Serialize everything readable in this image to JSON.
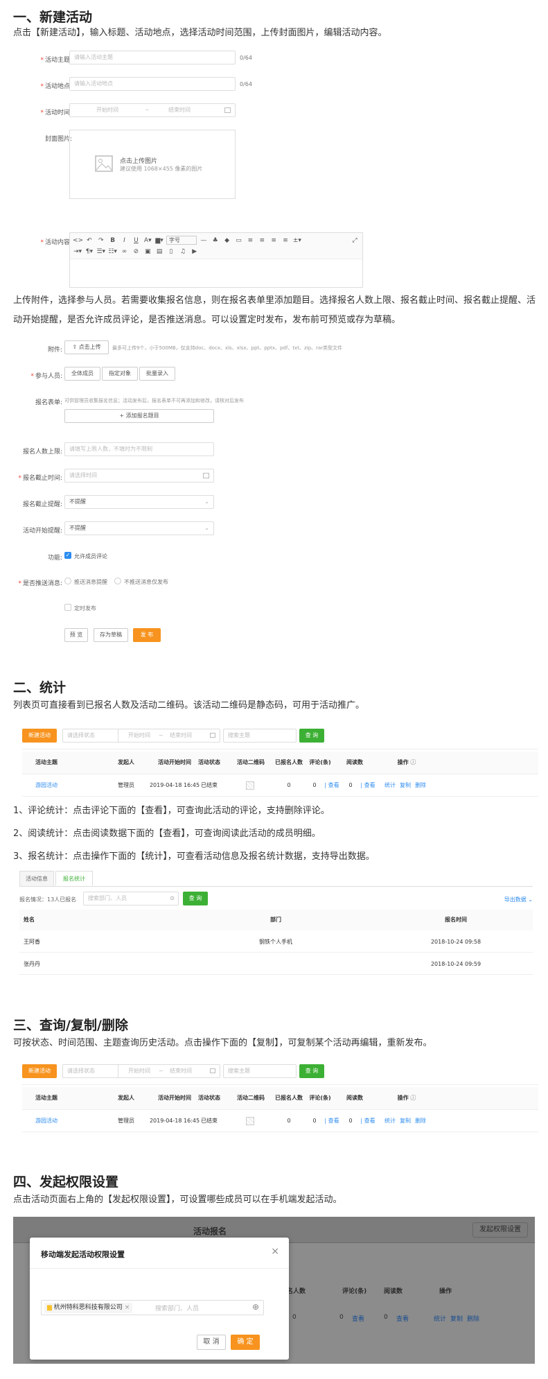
{
  "s1": {
    "heading": "一、新建活动",
    "desc": "点击【新建活动】，输入标题、活动地点，选择活动时间范围，上传封面图片，编辑活动内容。",
    "theme_label": "活动主题:",
    "theme_placeholder": "请输入活动主题",
    "theme_count": "0/64",
    "place_label": "活动地点:",
    "place_placeholder": "请输入活动地点",
    "place_count": "0/64",
    "time_label": "活动时间:",
    "time_start": "开始时间",
    "time_sep": "~",
    "time_end": "结束时间",
    "cover_label": "封面图片:",
    "cover_upload": "点击上传图片",
    "cover_hint": "建议使用 1068×455 像素的图片",
    "content_label": "活动内容:",
    "font_size": "字号"
  },
  "s1b": {
    "desc": "上传附件，选择参与人员。若需要收集报名信息，则在报名表单里添加题目。选择报名人数上限、报名截止时间、报名截止提醒、活动开始提醒，是否允许成员评论，是否推送消息。可以设置定时发布，发布前可预览或存为草稿。",
    "attach_label": "附件:",
    "attach_btn": "点击上传",
    "attach_hint": "最多可上传9个，小于500MB，仅支持doc、docx、xls、xlsx、ppt、pptx、pdf、txt、zip、rar类型文件",
    "people_label": "参与人员:",
    "people_all": "全体成员",
    "people_specified": "指定对象",
    "people_batch": "批量录入",
    "form_label": "报名表单:",
    "form_hint": "可供管理员收集报名信息；活动发布后，报名表单不可再添加和修改，请核对后发布",
    "form_add": "添加报名题目",
    "limit_label": "报名人数上限:",
    "limit_placeholder": "请填写上限人数，不填时为不限制",
    "deadline_label": "报名截止时间:",
    "deadline_placeholder": "请选择时间",
    "remind_label": "报名截止提醒:",
    "remind_value": "不提醒",
    "start_remind_label": "活动开始提醒:",
    "start_remind_value": "不提醒",
    "func_label": "功能:",
    "func_allow": "允许成员评论",
    "push_label": "是否推送消息:",
    "push_yes": "推送消息提醒",
    "push_no": "不推送消息仅发布",
    "schedule": "定时发布",
    "preview": "预 览",
    "draft": "存为草稿",
    "publish": "发 布"
  },
  "s2": {
    "heading": "二、统计",
    "desc": "列表页可直接看到已报名人数及活动二维码。该活动二维码是静态码，可用于活动推广。",
    "line1": "1、评论统计：点击评论下面的【查看】，可查询此活动的评论，支持删除评论。",
    "line2": "2、阅读统计：点击阅读数据下面的【查看】，可查询阅读此活动的成员明细。",
    "line3": "3、报名统计：点击操作下面的【统计】，可查看活动信息及报名统计数据，支持导出数据。",
    "tab_info": "活动信息",
    "tab_stat": "报名统计",
    "stat_summary": "报名情况：13人已报名",
    "stat_search": "搜索部门、人员",
    "stat_query": "查 询",
    "stat_export": "导出数据",
    "stat_cols": [
      "姓名",
      "部门",
      "报名时间"
    ],
    "stat_rows": [
      [
        "王阿香",
        "钢铁个人手机",
        "2018-10-24 09:58"
      ],
      [
        "张丹丹",
        "",
        "2018-10-24 09:59"
      ]
    ]
  },
  "list": {
    "new_btn": "新建活动",
    "status_placeholder": "请选择状态",
    "start": "开始时间",
    "end": "结束时间",
    "search": "搜索主题",
    "query": "查 询",
    "cols": [
      "活动主题",
      "发起人",
      "活动开始时间",
      "活动状态",
      "活动二维码",
      "已报名人数",
      "评论(条)",
      "阅读数",
      "操作"
    ],
    "row": {
      "theme": "游园活动",
      "creator": "管理员",
      "time": "2019-04-18 16:45",
      "status": "已结束",
      "signed": "0",
      "comments": "0",
      "view": "查看",
      "reads": "0",
      "op_stat": "统计",
      "op_copy": "复制",
      "op_del": "删除"
    }
  },
  "s3": {
    "heading": "三、查询/复制/删除",
    "desc": "可按状态、时间范围、主题查询历史活动。点击操作下面的【复制】，可复制某个活动再编辑，重新发布。"
  },
  "s4": {
    "heading": "四、发起权限设置",
    "desc": "点击活动页面右上角的【发起权限设置】，可设置哪些成员可以在手机端发起活动。",
    "page_title": "活动报名",
    "perm_btn": "发起权限设置",
    "modal_title": "移动端发起活动权限设置",
    "org_tag": "杭州特科思科技有限公司",
    "search": "搜索部门、人员",
    "cancel": "取 消",
    "ok": "确 定",
    "bg_cols": [
      "名人数",
      "评论(条)",
      "阅读数",
      "操作"
    ],
    "bg_vals": [
      "0",
      "0",
      "查看",
      "0",
      "查看",
      "统计",
      "复制",
      "删除"
    ]
  }
}
